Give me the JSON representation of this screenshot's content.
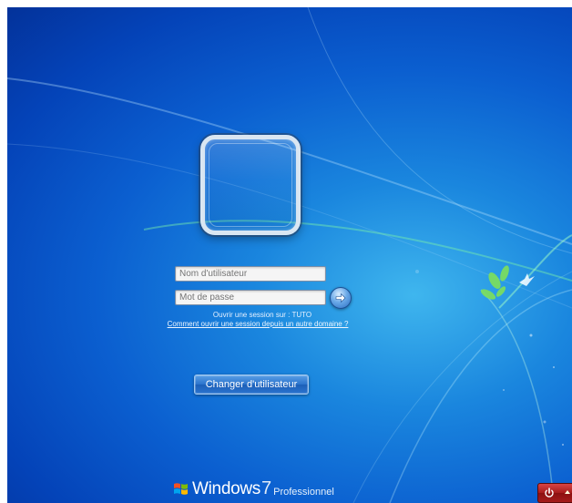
{
  "login": {
    "username_placeholder": "Nom d'utilisateur",
    "password_placeholder": "Mot de passe",
    "session_domain": "Ouvrir une session sur : TUTO",
    "help_link": "Comment ouvrir une session depuis un autre domaine ?",
    "switch_user_label": "Changer d'utilisateur"
  },
  "branding": {
    "name": "Windows",
    "version": "7",
    "edition": "Professionnel"
  },
  "icons": {
    "submit": "arrow-right-circle-icon",
    "power": "power-icon",
    "logo": "windows-logo-icon"
  },
  "colors": {
    "background": "#0b5fd0",
    "accent": "#2b73cc",
    "power": "#a61b1b"
  }
}
